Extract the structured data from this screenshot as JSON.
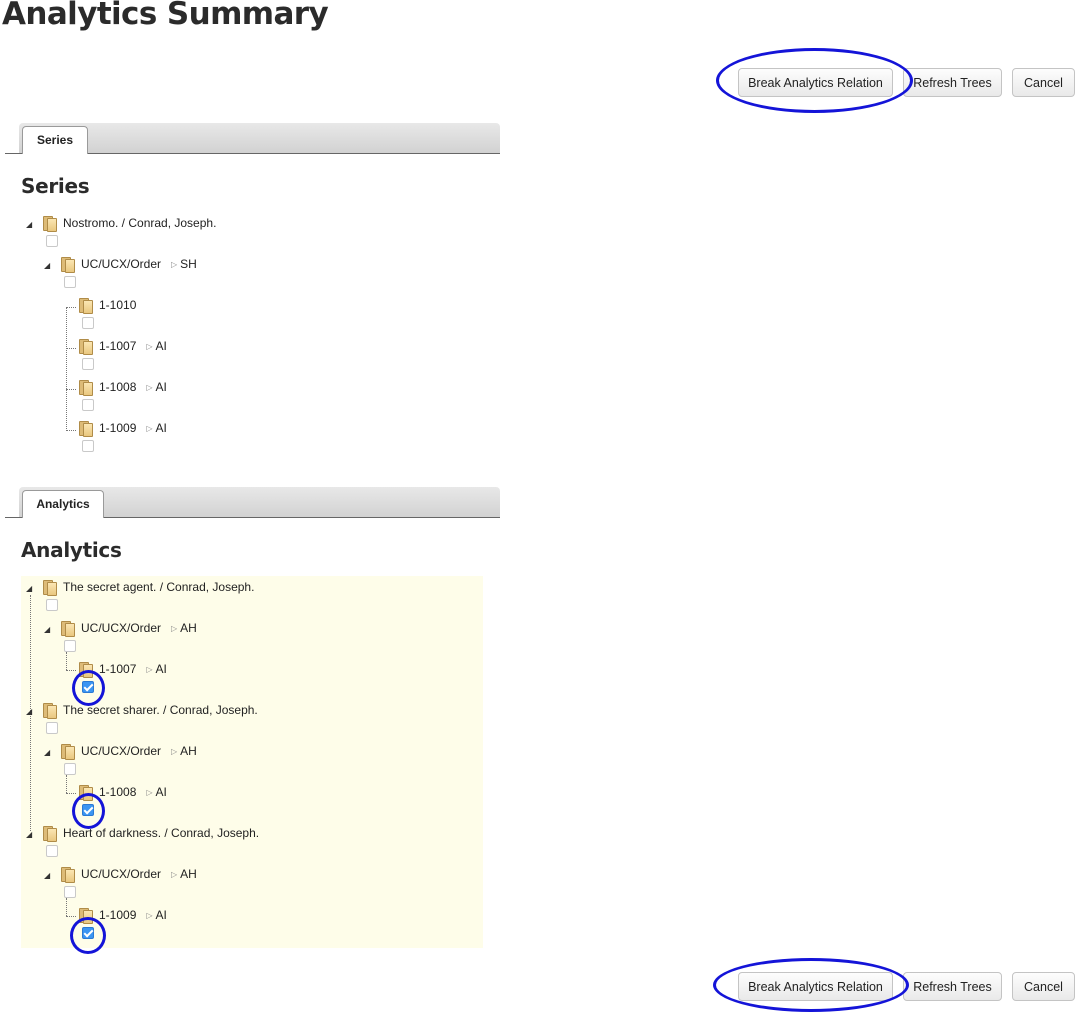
{
  "page": {
    "title": "Analytics Summary"
  },
  "toolbar": {
    "break_label": "Break Analytics Relation",
    "refresh_label": "Refresh Trees",
    "cancel_label": "Cancel"
  },
  "series_tab": {
    "tab_label": "Series",
    "heading": "Series",
    "tree": {
      "root": {
        "title": "Nostromo. / Conrad, Joseph.",
        "checked": false
      },
      "group": {
        "title": "UC/UCX/Order",
        "level": "SH",
        "checked": false
      },
      "items": [
        {
          "title": "1-1010",
          "level": "",
          "checked": false
        },
        {
          "title": "1-1007",
          "level": "AI",
          "checked": false
        },
        {
          "title": "1-1008",
          "level": "AI",
          "checked": false
        },
        {
          "title": "1-1009",
          "level": "AI",
          "checked": false
        }
      ]
    }
  },
  "analytics_tab": {
    "tab_label": "Analytics",
    "heading": "Analytics",
    "trees": [
      {
        "title": "The secret agent. / Conrad, Joseph.",
        "group": "UC/UCX/Order",
        "group_level": "AH",
        "item": "1-1007",
        "item_level": "AI",
        "checked": true
      },
      {
        "title": "The secret sharer. / Conrad, Joseph.",
        "group": "UC/UCX/Order",
        "group_level": "AH",
        "item": "1-1008",
        "item_level": "AI",
        "checked": true
      },
      {
        "title": "Heart of darkness. / Conrad, Joseph.",
        "group": "UC/UCX/Order",
        "group_level": "AH",
        "item": "1-1009",
        "item_level": "AI",
        "checked": true
      }
    ]
  },
  "icons": {
    "toggle": "tree-toggle-icon",
    "folder": "folder-icon",
    "arrow": "arrow-right-icon",
    "annotation": "highlight-ring"
  },
  "colors": {
    "highlight_ring": "#1414d8",
    "tree_background": "#fefde9",
    "checkbox_checked": "#3b95f2"
  }
}
